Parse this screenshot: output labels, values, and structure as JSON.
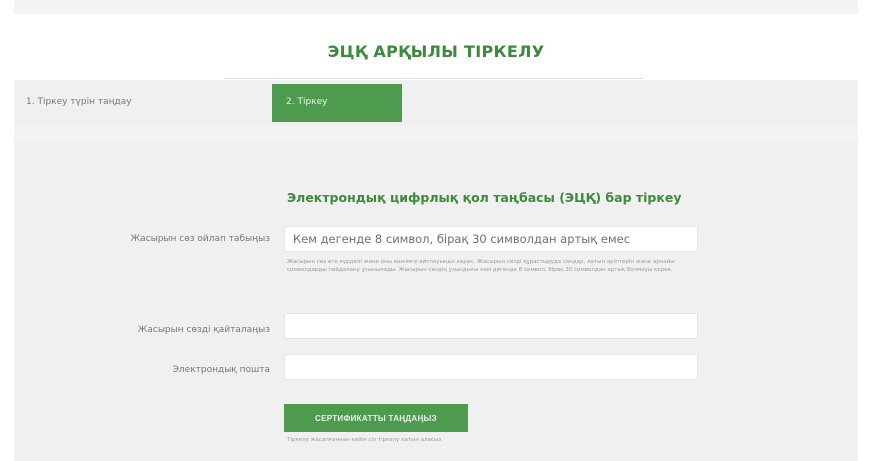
{
  "header": {
    "title": "ЭЦҚ АРҚЫЛЫ ТІРКЕЛУ"
  },
  "steps": [
    {
      "label": "1. Тіркеу түрін таңдау",
      "active": false
    },
    {
      "label": "2. Тіркеу",
      "active": true
    }
  ],
  "form": {
    "heading": "Электрондық цифрлық қол таңбасы (ЭЦҚ) бар тіркеу",
    "password": {
      "label": "Жасырын сөз ойлап табыңыз",
      "placeholder": "Кем дегенде 8 символ, бірақ 30 символдан артық емес",
      "value": ""
    },
    "password_help": "Жасырын сөз өте күрделі және оны ешкімге айтпауыңыз керек. Жасырын сөзді құрастыруда сандар, латын әріптерін және арнайы символдарды пайдалану ұсынылады. Жасырын сөздің ұзындығы кем дегенде 8 символ, бірақ 30 символдан артық болмауы керек.",
    "password_repeat": {
      "label": "Жасырын сөзді қайталаңыз",
      "value": ""
    },
    "email": {
      "label": "Электрондық пошта",
      "value": ""
    },
    "submit_label": "СЕРТИФИКАТТЫ ТАҢДАҢЫЗ",
    "note": "Тіркелу жасалғаннан кейін сіз тіркелу хатын аласыз"
  },
  "colors": {
    "accent": "#4e9a4e",
    "title": "#3d8a3d",
    "panel": "#f0f0f0"
  }
}
